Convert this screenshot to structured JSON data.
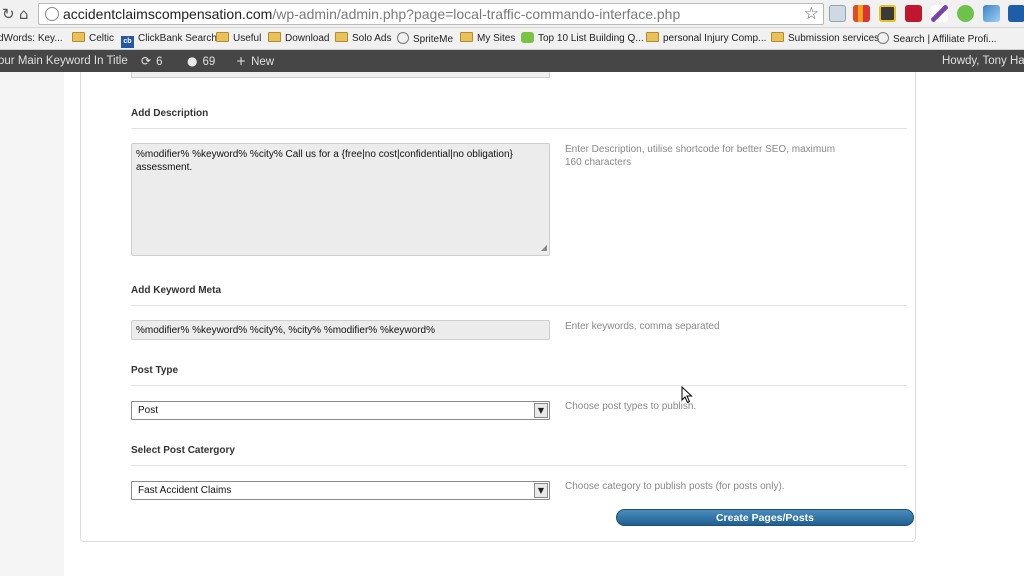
{
  "browser": {
    "url_host": "accidentclaimscompensation.com",
    "url_path": "/wp-admin/admin.php?page=local-traffic-commando-interface.php"
  },
  "bookmarks": [
    {
      "label": "dWords: Key...",
      "icon": "none"
    },
    {
      "label": "Celtic",
      "icon": "folder-icon"
    },
    {
      "label": "ClickBank Search",
      "icon": "clickbank-icon"
    },
    {
      "label": "Useful",
      "icon": "folder-icon"
    },
    {
      "label": "Download",
      "icon": "folder-icon"
    },
    {
      "label": "Solo Ads",
      "icon": "folder-icon"
    },
    {
      "label": "SpriteMe",
      "icon": "globe-icon"
    },
    {
      "label": "My Sites",
      "icon": "folder-icon"
    },
    {
      "label": "Top 10 List Building Q...",
      "icon": "speech-bubble-icon"
    },
    {
      "label": "personal Injury Comp...",
      "icon": "folder-icon"
    },
    {
      "label": "Submission services",
      "icon": "folder-icon"
    },
    {
      "label": "Search | Affiliate Profi...",
      "icon": "globe-icon"
    }
  ],
  "admin_bar": {
    "site_title": "our Main Keyword In Title",
    "updates_count": "6",
    "comments_count": "69",
    "new_label": "New",
    "howdy": "Howdy, Tony Ha"
  },
  "form": {
    "description": {
      "title": "Add Description",
      "value": "%modifier% %keyword% %city% Call us for a {free|no cost|confidential|no obligation} assessment.",
      "help_line1": "Enter Description, utilise shortcode for better SEO, maximum",
      "help_line2": "160 characters"
    },
    "keyword_meta": {
      "title": "Add Keyword Meta",
      "value": "%modifier% %keyword% %city%, %city% %modifier% %keyword%",
      "help": "Enter keywords, comma separated"
    },
    "post_type": {
      "title": "Post Type",
      "selected": "Post",
      "help": "Choose post types to publish."
    },
    "post_category": {
      "title": "Select Post Catergory",
      "selected": "Fast Accident Claims",
      "help": "Choose category to publish posts (for posts only)."
    },
    "submit_label": "Create Pages/Posts"
  },
  "colors": {
    "admin_bar": "#464646",
    "button": "#2a6fa3",
    "help_text": "#888888"
  }
}
